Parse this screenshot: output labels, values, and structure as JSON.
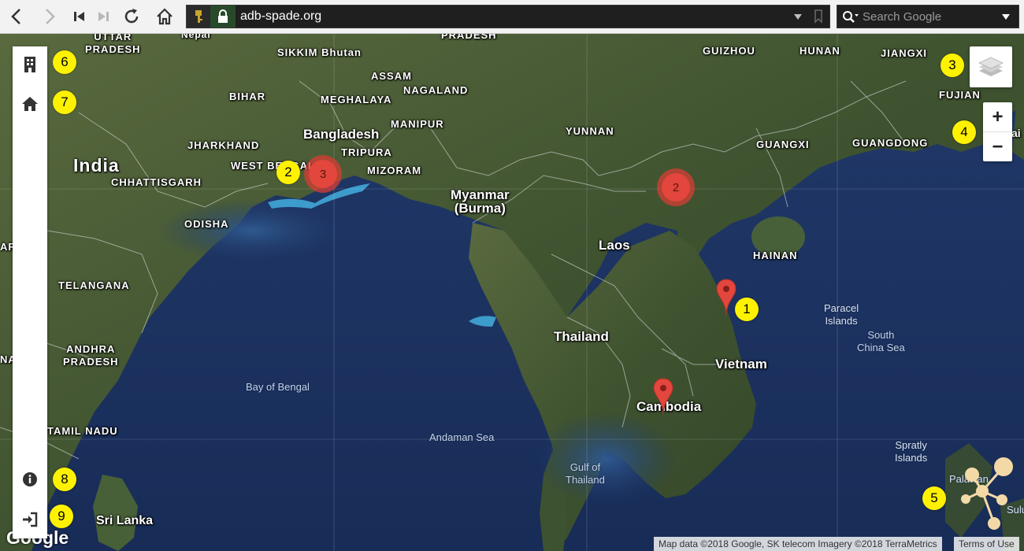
{
  "browser": {
    "url": "adb-spade.org",
    "search_placeholder": "Search Google"
  },
  "map": {
    "labels": {
      "uttar_pradesh": "UTTAR\nPRADESH",
      "nepal": "Nepal",
      "sikkim_bhutan": "SIKKIM Bhutan",
      "pradesh_top": "PRADESH",
      "assam": "ASSAM",
      "bihar": "BIHAR",
      "meghalaya": "MEGHALAYA",
      "nagaland": "NAGALAND",
      "manipur": "MANIPUR",
      "bangladesh": "Bangladesh",
      "jharkhand": "JHARKHAND",
      "tripura": "TRIPURA",
      "india": "India",
      "west_bengal": "WEST BENGAL",
      "mizoram": "MIZORAM",
      "chhattisgarh": "CHHATTISGARH",
      "myanmar": "Myanmar\n(Burma)",
      "odisha": "ODISHA",
      "telangana": "TELANGANA",
      "andhra": "ANDHRA\nPRADESH",
      "bay_of_bengal": "Bay of Bengal",
      "tamil_nadu": "TAMIL NADU",
      "andaman_sea": "Andaman Sea",
      "sri_lanka": "Sri Lanka",
      "yunnan": "YUNNAN",
      "guizhou": "GUIZHOU",
      "hunan": "HUNAN",
      "jiangxi": "JIANGXI",
      "fujian": "FUJIAN",
      "guangxi": "GUANGXI",
      "guangdong": "GUANGDONG",
      "laos": "Laos",
      "hainan": "HAINAN",
      "thailand": "Thailand",
      "vietnam": "Vietnam",
      "cambodia": "Cambodia",
      "paracel": "Paracel\nIslands",
      "south_china_sea": "South\nChina Sea",
      "gulf_thailand": "Gulf of\nThailand",
      "spratly": "Spratly\nIslands",
      "palawan": "Palawan",
      "sulu": "Sulu",
      "ara": "ARA",
      "na": "NA",
      "ai": "ai"
    },
    "clusters": [
      {
        "count": "3"
      },
      {
        "count": "2"
      }
    ],
    "attribution": "Map data ©2018 Google, SK telecom Imagery ©2018 TerraMetrics",
    "terms": "Terms of Use",
    "google_logo": "Google"
  },
  "controls": {
    "zoom_in": "+",
    "zoom_out": "−"
  },
  "badges": [
    "1",
    "2",
    "3",
    "4",
    "5",
    "6",
    "7",
    "8",
    "9"
  ],
  "colors": {
    "marker_red": "#e2463c",
    "badge_yellow": "#fff200",
    "ocean": "#1d3563",
    "land": "#4b5a33"
  }
}
